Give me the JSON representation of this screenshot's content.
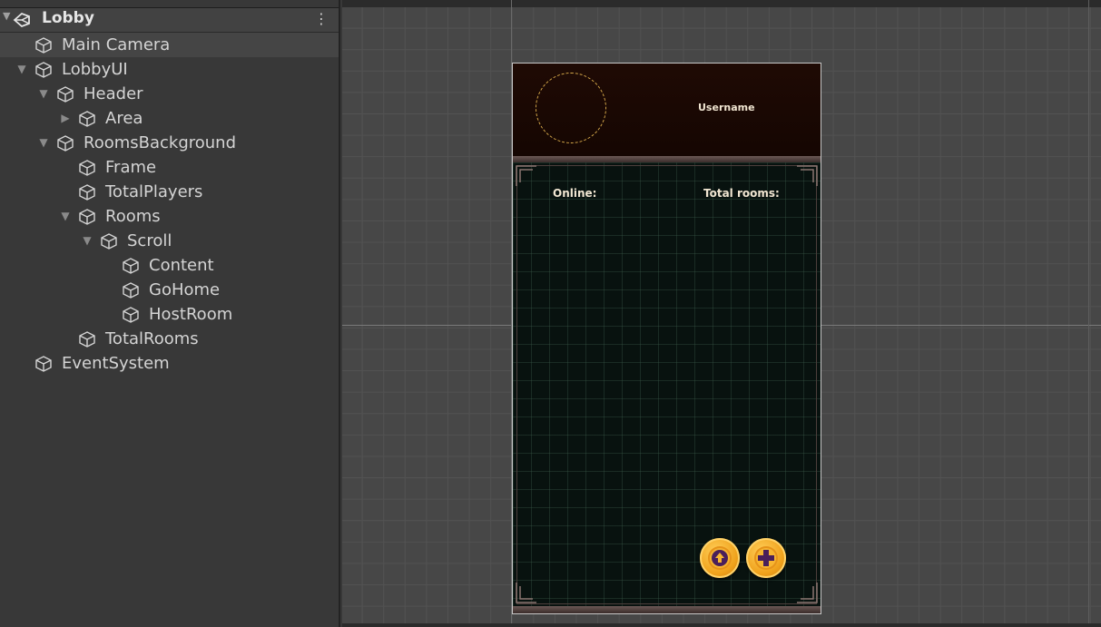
{
  "hierarchy": {
    "scene_name": "Lobby",
    "menu_icon": "kebab-menu-icon",
    "items": [
      {
        "label": "Main Camera"
      },
      {
        "label": "LobbyUI"
      },
      {
        "label": "Header"
      },
      {
        "label": "Area"
      },
      {
        "label": "RoomsBackground"
      },
      {
        "label": "Frame"
      },
      {
        "label": "TotalPlayers"
      },
      {
        "label": "Rooms"
      },
      {
        "label": "Scroll"
      },
      {
        "label": "Content"
      },
      {
        "label": "GoHome"
      },
      {
        "label": "HostRoom"
      },
      {
        "label": "TotalRooms"
      },
      {
        "label": "EventSystem"
      }
    ]
  },
  "game_ui": {
    "username": "Username",
    "online_label": "Online:",
    "total_rooms_label": "Total rooms:",
    "go_home_icon": "home-arrow-icon",
    "host_room_icon": "plus-icon"
  },
  "colors": {
    "accent_gold": "#f0a21c",
    "header_bg": "#1f0a04",
    "rooms_bg": "#08120f",
    "icon_purple": "#4a1f5a"
  }
}
